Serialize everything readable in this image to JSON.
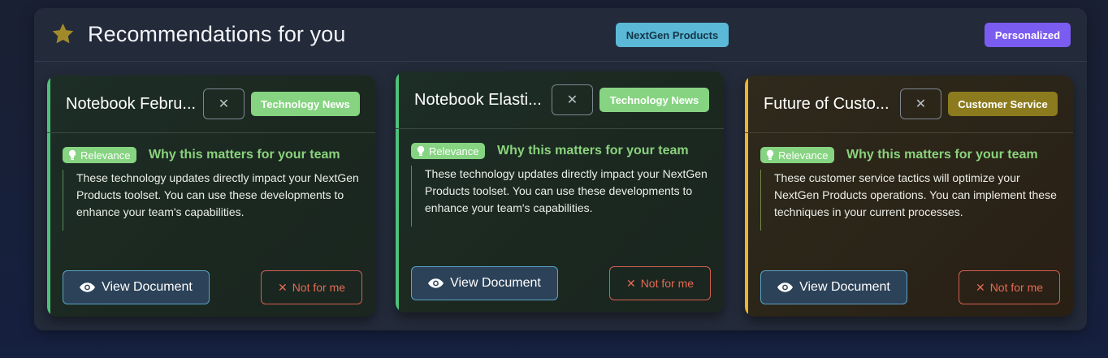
{
  "header": {
    "title": "Recommendations for you",
    "star_icon": "star-icon",
    "badges": {
      "nextgen": "NextGen Products",
      "personalized": "Personalized"
    }
  },
  "colors": {
    "star": "#a08a2a",
    "green_accent": "#4ec27a",
    "amber_accent": "#f0b429",
    "tech_badge": "#86d481",
    "customer_badge": "#8c7b1e",
    "nextgen_badge": "#5bb8d6",
    "personalized_badge": "#7b5cf0"
  },
  "cards": [
    {
      "title": "Notebook Febru...",
      "close_label": "✕",
      "topic": "Technology News",
      "relevance_label": "Relevance",
      "why": "Why this matters for your team",
      "description": "These technology updates directly impact your NextGen Products toolset. You can use these developments to enhance your team's capabilities.",
      "view_label": "View Document",
      "not_for_me_label": "Not for me",
      "not_for_me_icon": "✕"
    },
    {
      "title": "Notebook Elasti...",
      "close_label": "✕",
      "topic": "Technology News",
      "relevance_label": "Relevance",
      "why": "Why this matters for your team",
      "description": "These technology updates directly impact your NextGen Products toolset. You can use these developments to enhance your team's capabilities.",
      "view_label": "View Document",
      "not_for_me_label": "Not for me",
      "not_for_me_icon": "✕"
    },
    {
      "title": "Future of Custo...",
      "close_label": "✕",
      "topic": "Customer Service",
      "relevance_label": "Relevance",
      "why": "Why this matters for your team",
      "description": "These customer service tactics will optimize your NextGen Products operations. You can implement these techniques in your current processes.",
      "view_label": "View Document",
      "not_for_me_label": "Not for me",
      "not_for_me_icon": "✕"
    }
  ]
}
